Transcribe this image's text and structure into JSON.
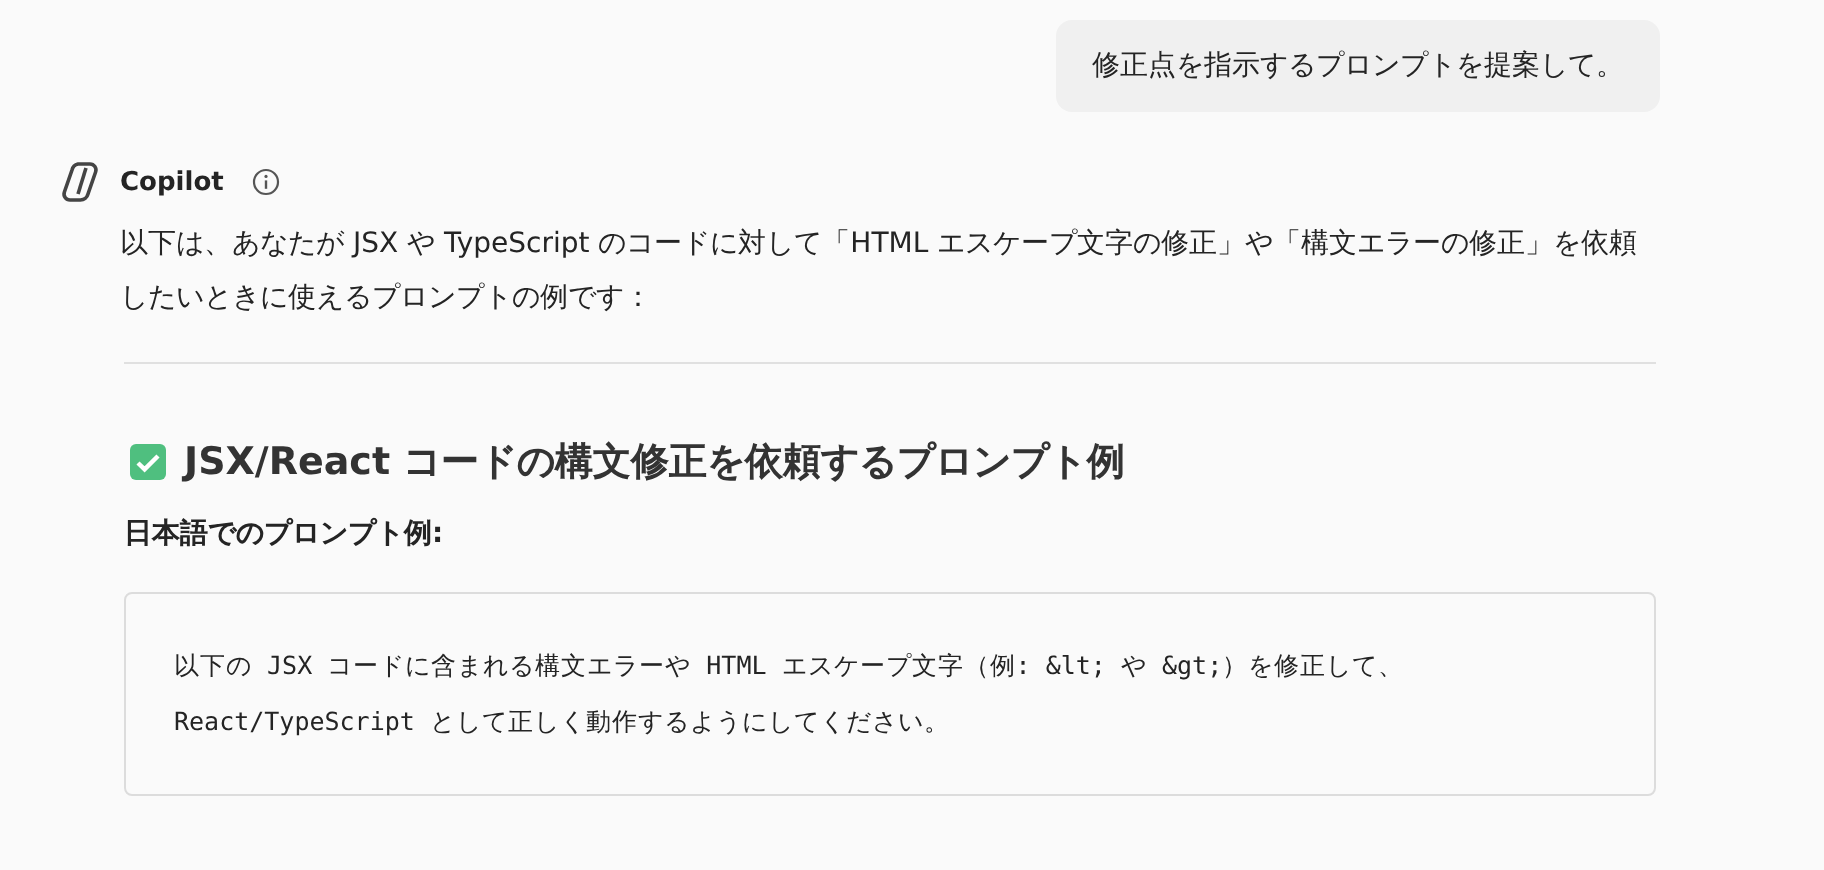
{
  "user_message": "修正点を指示するプロンプトを提案して。",
  "assistant": {
    "name": "Copilot",
    "intro": "以下は、あなたが JSX や TypeScript のコードに対して「HTML エスケープ文字の修正」や「構文エラーの修正」を依頼したいときに使えるプロンプトの例です：",
    "heading": {
      "checked": true,
      "text": "JSX/React コードの構文修正を依頼するプロンプト例"
    },
    "subheading": "日本語でのプロンプト例:",
    "code_lines": [
      "以下の JSX コードに含まれる構文エラーや HTML エスケープ文字（例: &lt; や &gt;）を修正して、",
      "React/TypeScript として正しく動作するようにしてください。"
    ]
  }
}
